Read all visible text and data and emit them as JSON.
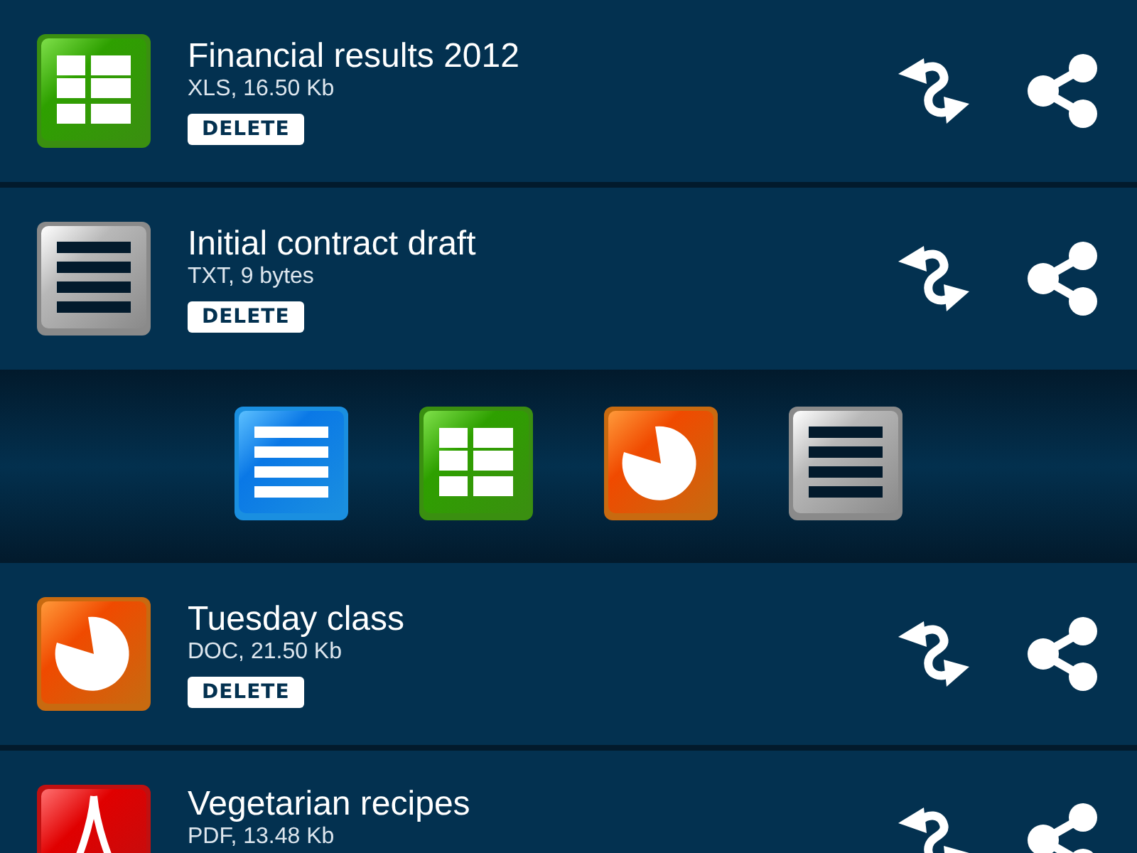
{
  "files": [
    {
      "kind": "spreadsheet",
      "title": "Financial results 2012",
      "details": "XLS, 16.50 Kb",
      "delete_label": "DELETE"
    },
    {
      "kind": "text",
      "title": "Initial contract draft",
      "details": "TXT, 9 bytes",
      "delete_label": "DELETE"
    },
    {
      "kind": "toolbar",
      "items": [
        {
          "kind": "document"
        },
        {
          "kind": "spreadsheet"
        },
        {
          "kind": "presentation"
        },
        {
          "kind": "text"
        }
      ]
    },
    {
      "kind": "presentation",
      "title": "Tuesday class",
      "details": "DOC, 21.50 Kb",
      "delete_label": "DELETE"
    },
    {
      "kind": "pdf",
      "title": "Vegetarian recipes",
      "details": "PDF, 13.48 Kb"
    }
  ]
}
